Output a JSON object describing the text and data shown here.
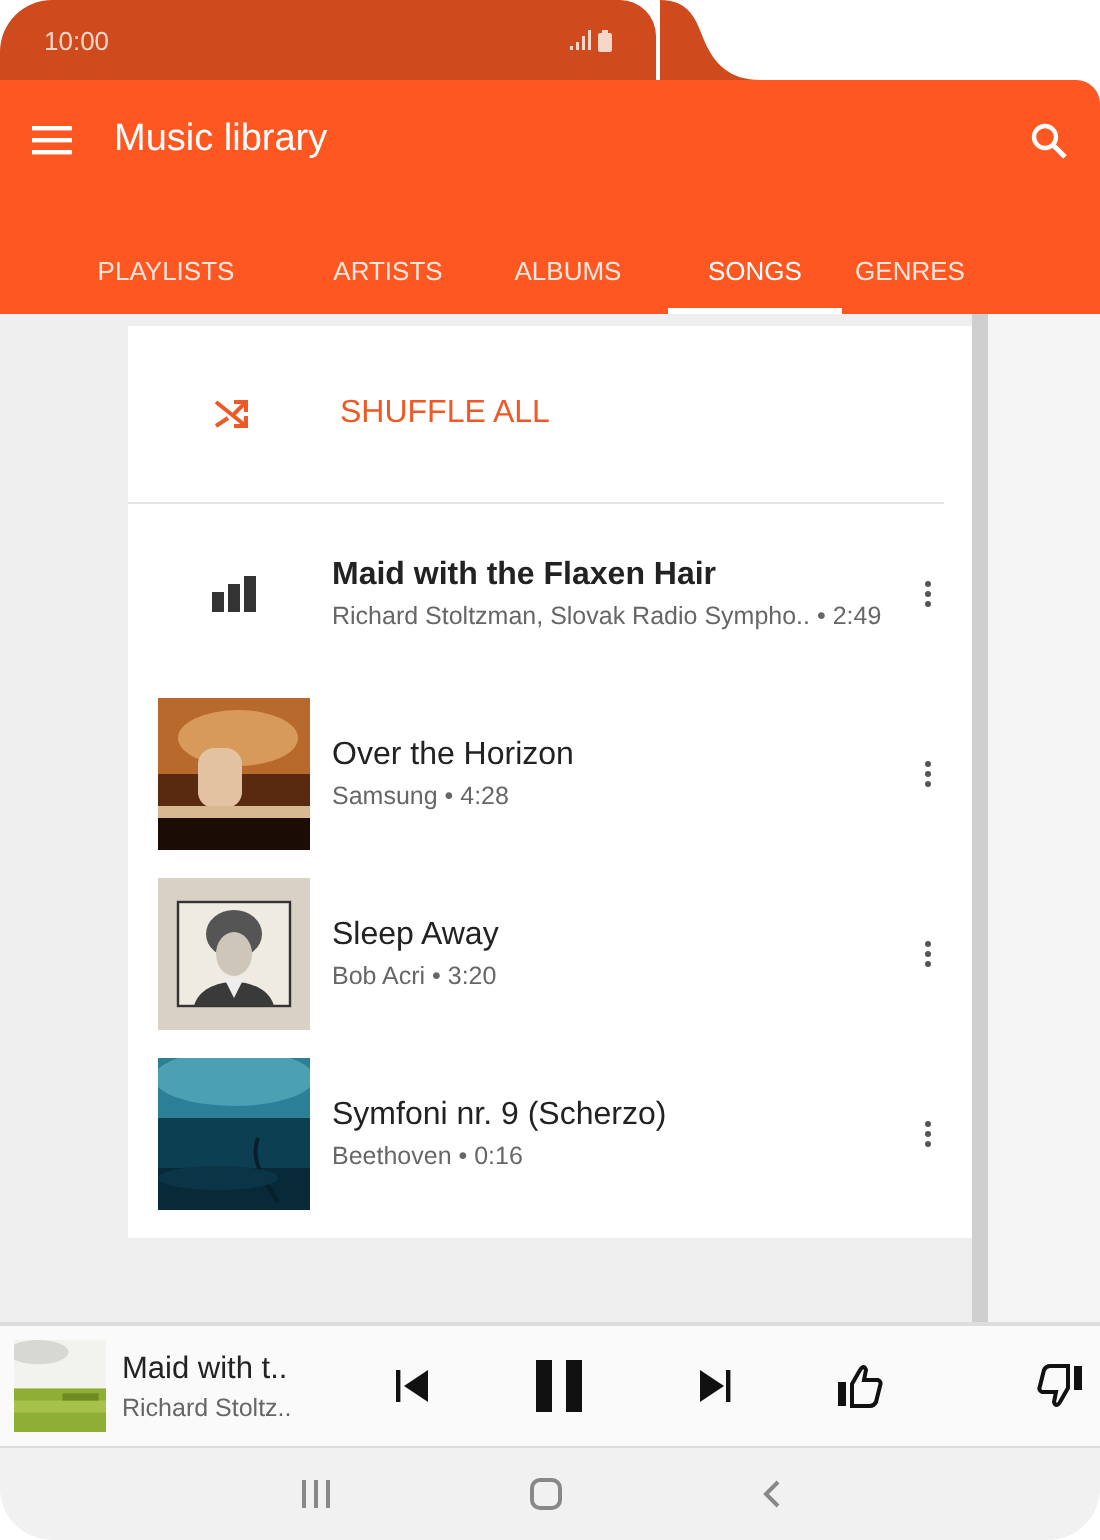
{
  "status_bar": {
    "time": "10:00"
  },
  "app_bar": {
    "title": "Music library"
  },
  "tabs": [
    {
      "label": "PLAYLISTS",
      "selected": false
    },
    {
      "label": "ARTISTS",
      "selected": false
    },
    {
      "label": "ALBUMS",
      "selected": false
    },
    {
      "label": "SONGS",
      "selected": true
    },
    {
      "label": "GENRES",
      "selected": false
    }
  ],
  "shuffle": {
    "label": "SHUFFLE ALL"
  },
  "songs": [
    {
      "kind": "playing",
      "title": "Maid with the Flaxen Hair",
      "subtitle": "Richard Stoltzman, Slovak Radio Sympho.. • 2:49"
    },
    {
      "kind": "art",
      "title": "Over the Horizon",
      "subtitle": "Samsung • 4:28"
    },
    {
      "kind": "art",
      "title": "Sleep Away",
      "subtitle": "Bob Acri • 3:20"
    },
    {
      "kind": "art",
      "title": "Symfoni nr. 9 (Scherzo)",
      "subtitle": "Beethoven • 0:16"
    }
  ],
  "now_playing": {
    "title": "Maid with t..",
    "artist": "Richard Stoltz..",
    "playing": true
  }
}
